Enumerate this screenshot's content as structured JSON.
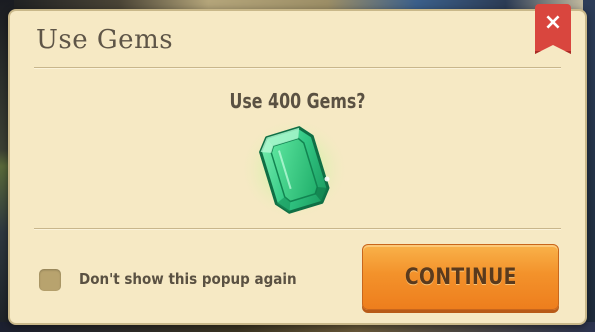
{
  "popup": {
    "title": "Use Gems",
    "question": "Use 400 Gems?",
    "close_label": "×",
    "checkbox": {
      "label": "Don't show this popup again",
      "checked": false
    },
    "continue_label": "CONTINUE"
  },
  "icons": {
    "close": "close-icon",
    "gem": "gem-icon"
  },
  "colors": {
    "panel": "#f6e9c4",
    "title_text": "#5e5547",
    "close_ribbon": "#d9463e",
    "button": "#f3922b",
    "gem": "#2fc47c"
  }
}
